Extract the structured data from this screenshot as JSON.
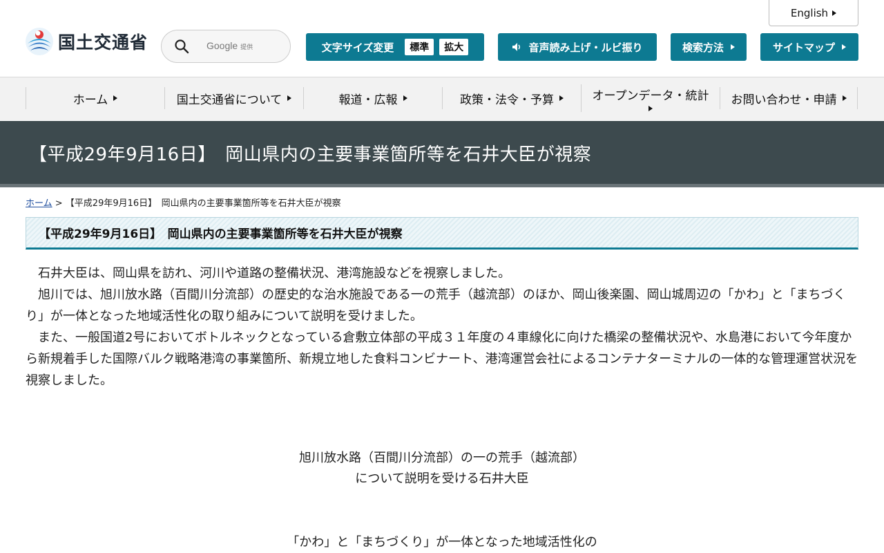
{
  "header": {
    "logo_text": "国土交通省",
    "search": {
      "brand": "Google",
      "brand_note": "提供",
      "placeholder": ""
    },
    "english_label": "English",
    "font_size": {
      "label": "文字サイズ変更",
      "standard": "標準",
      "large": "拡大"
    },
    "read_aloud_label": "音声読み上げ・ルビ振り",
    "search_method_label": "検索方法",
    "sitemap_label": "サイトマップ"
  },
  "nav": {
    "items": [
      {
        "label": "ホーム"
      },
      {
        "label": "国土交通省について"
      },
      {
        "label": "報道・広報"
      },
      {
        "label": "政策・法令・予算"
      },
      {
        "label": "オープンデータ・統計"
      },
      {
        "label": "お問い合わせ・申請"
      }
    ]
  },
  "page": {
    "title": "【平成29年9月16日】　岡山県内の主要事業箇所等を石井大臣が視察",
    "breadcrumb": {
      "home": "ホーム",
      "separator": " > ",
      "current": "【平成29年9月16日】　岡山県内の主要事業箇所等を石井大臣が視察"
    },
    "heading": "【平成29年9月16日】　岡山県内の主要事業箇所等を石井大臣が視察",
    "paragraphs": [
      "石井大臣は、岡山県を訪れ、河川や道路の整備状況、港湾施設などを視察しました。",
      "旭川では、旭川放水路（百間川分流部）の歴史的な治水施設である一の荒手（越流部）のほか、岡山後楽園、岡山城周辺の「かわ」と「まちづくり」が一体となった地域活性化の取り組みについて説明を受けました。",
      "また、一般国道2号においてボトルネックとなっている倉敷立体部の平成３１年度の４車線化に向けた橋梁の整備状況や、水島港において今年度から新規着手した国際バルク戦略港湾の事業箇所、新規立地した食料コンビナート、港湾運営会社によるコンテナターミナルの一体的な管理運営状況を視察しました。"
    ],
    "caption1": [
      "旭川放水路（百間川分流部）の一の荒手（越流部）",
      "について説明を受ける石井大臣"
    ],
    "caption2": [
      "「かわ」と「まちづくり」が一体となった地域活性化の"
    ]
  },
  "colors": {
    "teal": "#0d7a92",
    "title_band": "#3d4a4e",
    "nav_bg": "#f2f2f2"
  }
}
